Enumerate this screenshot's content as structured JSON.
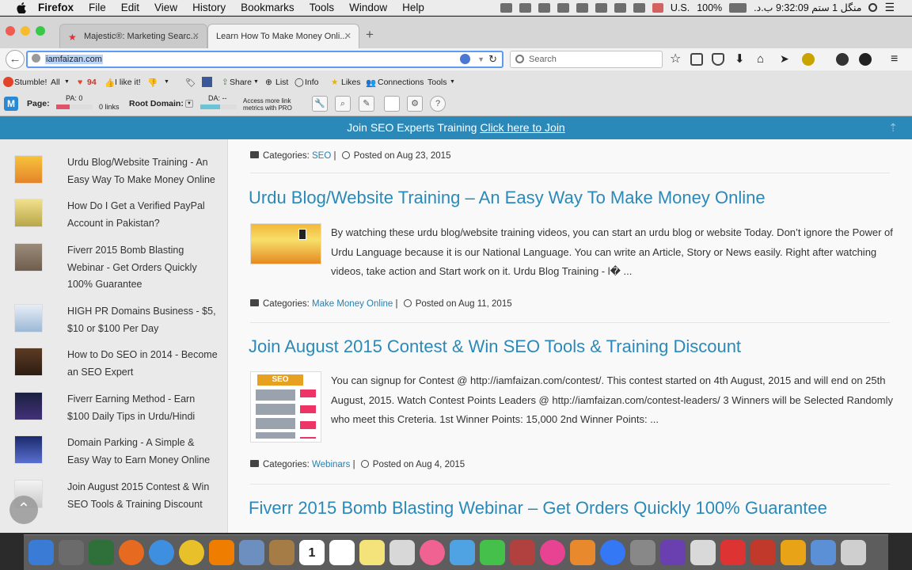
{
  "menubar": {
    "app": "Firefox",
    "items": [
      "File",
      "Edit",
      "View",
      "History",
      "Bookmarks",
      "Tools",
      "Window",
      "Help"
    ],
    "input_lang": "U.S.",
    "battery": "100%",
    "clock": "منگل 1 ستم 9:32:09 ب.د."
  },
  "tabs": [
    {
      "label": "Majestic®: Marketing Searc...",
      "active": false
    },
    {
      "label": "Learn How To Make Money Onli...",
      "active": true
    }
  ],
  "nav": {
    "url": "iamfaizan.com",
    "search_placeholder": "Search"
  },
  "stumble_bar": {
    "stumble": "Stumble!",
    "all": "All",
    "count": "94",
    "like": "I like it!",
    "share": "Share",
    "list": "List",
    "info": "Info",
    "likes": "Likes",
    "connections": "Connections",
    "tools": "Tools"
  },
  "moz_bar": {
    "page_label": "Page:",
    "pa": "PA: 0",
    "links": "0 links",
    "root_domain": "Root Domain:",
    "da": "DA: --",
    "pro_note_1": "Access more link",
    "pro_note_2": "metrics with PRO"
  },
  "banner": {
    "text": "Join SEO Experts Training ",
    "cta": "Click here to Join"
  },
  "sidebar": {
    "items": [
      {
        "title": "Urdu Blog/Website Training - An Easy Way To Make Money Online"
      },
      {
        "title": "How Do I Get a Verified PayPal Account in Pakistan?"
      },
      {
        "title": "Fiverr 2015 Bomb Blasting Webinar - Get Orders Quickly 100% Guarantee"
      },
      {
        "title": "HIGH PR Domains Business - $5, $10 or $100 Per Day"
      },
      {
        "title": "How to Do SEO in 2014 - Become an SEO Expert"
      },
      {
        "title": "Fiverr Earning Method - Earn $100 Daily Tips in Urdu/Hindi"
      },
      {
        "title": "Domain Parking - A Simple & Easy Way to Earn Money Online"
      },
      {
        "title": "Join August 2015 Contest & Win SEO Tools & Training Discount"
      }
    ]
  },
  "posts": [
    {
      "meta_prefix": "Categories: ",
      "category": "SEO",
      "date": "Posted on Aug 23, 2015"
    },
    {
      "title": "Urdu Blog/Website Training – An Easy Way To Make Money Online",
      "excerpt": "By watching these urdu blog/website training videos, you can start an urdu blog or website Today. Don’t ignore the Power of Urdu Language because it is our National Language. You can write an Article, Story or News easily. Right after watching videos, take action and Start work on it. Urdu Blog Training - l� ...",
      "meta_prefix": "Categories: ",
      "category": "Make Money Online",
      "date": "Posted on Aug 11, 2015"
    },
    {
      "title": "Join August 2015 Contest & Win SEO Tools & Training Discount",
      "excerpt": "You can signup for Contest @ http://iamfaizan.com/contest/. This contest started on 4th August, 2015 and will end on 25th August, 2015. Watch Contest Points Leaders @ http://iamfaizan.com/contest-leaders/ 3 Winners will be Selected Randomly who meet this Creteria. 1st Winner Points: 15,000 2nd Winner Points: ...",
      "meta_prefix": "Categories: ",
      "category": "Webinars",
      "date": "Posted on Aug 4, 2015",
      "thumb_label": "SEO"
    },
    {
      "title": "Fiverr 2015 Bomb Blasting Webinar – Get Orders Quickly 100% Guarantee"
    }
  ],
  "dock": {
    "calendar_day": "1",
    "colors": [
      "#3a7bd5",
      "#6b6b6b",
      "#2e6f3a",
      "#e66a1f",
      "#3f8fe0",
      "#e8c02a",
      "#ef7d00",
      "#6d8fbf",
      "#a57b46",
      "#ffffff",
      "#ffffff",
      "#f4e27a",
      "#d8d8d8",
      "#f06292",
      "#4fa3e3",
      "#45c04a",
      "#b0413e",
      "#e84393",
      "#e8892e",
      "#3478f6",
      "#888888",
      "#6a3fb0",
      "#d9d9d9",
      "#d33",
      "#c0392b",
      "#e8a317",
      "#5b8fd6",
      "#cfcfcf"
    ]
  }
}
